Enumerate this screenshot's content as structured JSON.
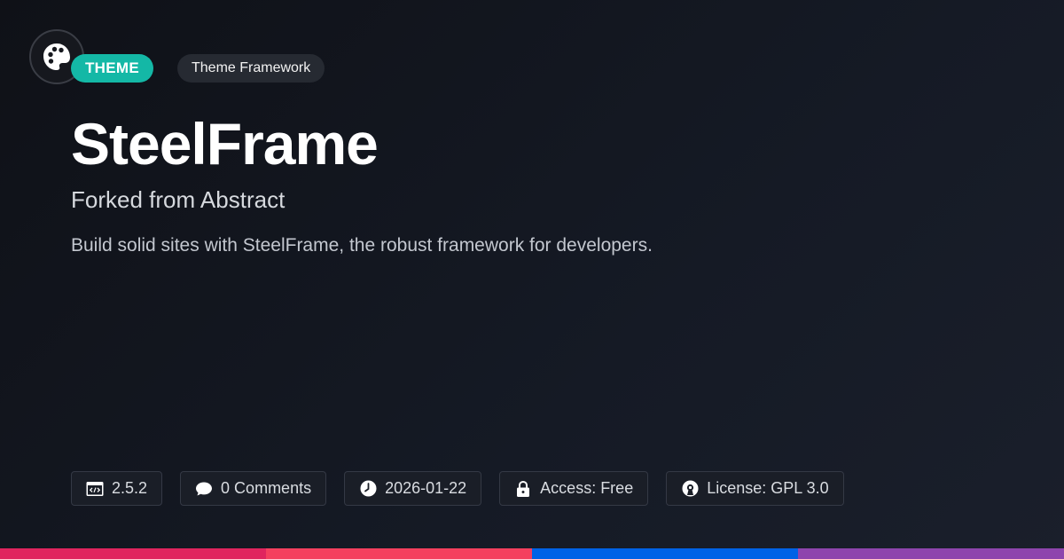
{
  "badges": {
    "primary": "THEME",
    "secondary": "Theme Framework"
  },
  "title": "SteelFrame",
  "subtitle": "Forked from Abstract",
  "description": "Build solid sites with SteelFrame, the robust framework for developers.",
  "meta": [
    {
      "icon": "code-window-icon",
      "label": "2.5.2"
    },
    {
      "icon": "comment-icon",
      "label": "0 Comments"
    },
    {
      "icon": "clock-icon",
      "label": "2026-01-22"
    },
    {
      "icon": "lock-icon",
      "label": "Access: Free"
    },
    {
      "icon": "open-source-icon",
      "label": "License: GPL 3.0"
    }
  ],
  "logo_icon": "palette-icon",
  "colors": {
    "accent": "#14b8a6",
    "bar": [
      "#e0245e",
      "#f43f5e",
      "#0062e6",
      "#8e44ad"
    ]
  }
}
